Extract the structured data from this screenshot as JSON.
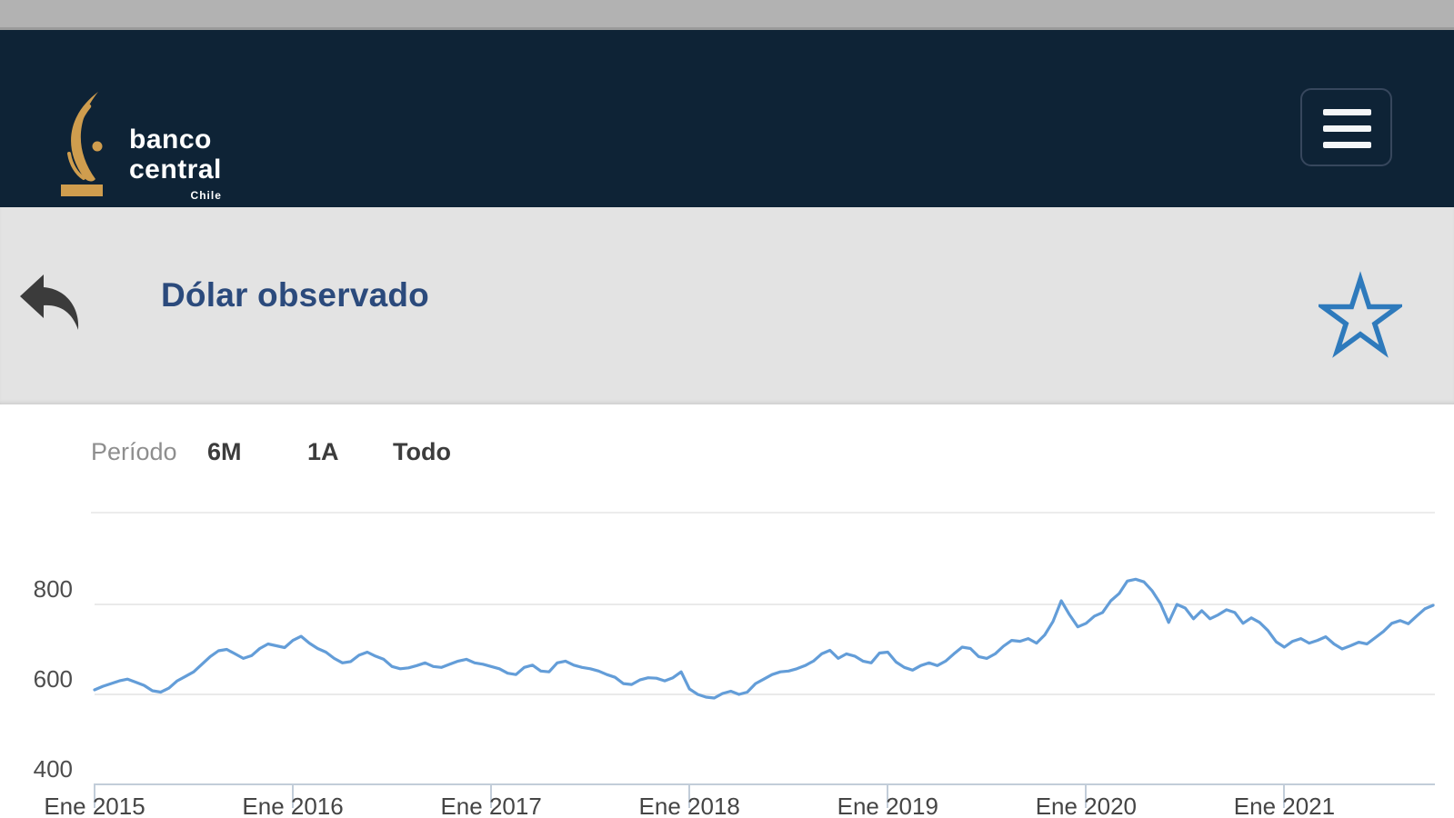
{
  "colors": {
    "status_gray": "#b2b2b2",
    "header_navy": "#0e2336",
    "bg_gray": "#e3e3e3",
    "title_navy": "#2b4a7c",
    "gold": "#cf9d4e",
    "accent_blue": "#2e7abc",
    "line_blue": "#639dd8"
  },
  "header": {
    "logo_line1": "banco",
    "logo_line2": "central",
    "logo_line3": "Chile",
    "menu_icon": "hamburger-icon"
  },
  "title_bar": {
    "title": "Dólar observado",
    "back_icon": "back-arrow-icon",
    "favorite_icon": "star-icon"
  },
  "period_selector": {
    "label": "Período",
    "options": [
      "6M",
      "1A",
      "Todo"
    ]
  },
  "chart_data": {
    "type": "line",
    "title": "Dólar observado",
    "series_name": "Dólar observado",
    "x_tick_labels": [
      "Ene 2015",
      "Ene 2016",
      "Ene 2017",
      "Ene 2018",
      "Ene 2019",
      "Ene 2020",
      "Ene 2021"
    ],
    "y_ticks": [
      800,
      600,
      400
    ],
    "ylim": [
      400,
      1000
    ],
    "grid": "horizontal",
    "legend": "none",
    "x_start": "Ene 2015",
    "x_interval": "half-month",
    "points_per_year": 24,
    "values": [
      608,
      616,
      622,
      628,
      632,
      625,
      618,
      606,
      603,
      612,
      628,
      638,
      648,
      665,
      682,
      695,
      698,
      688,
      678,
      684,
      700,
      710,
      706,
      702,
      718,
      727,
      712,
      700,
      692,
      678,
      668,
      671,
      685,
      692,
      683,
      676,
      660,
      655,
      657,
      662,
      668,
      660,
      658,
      665,
      672,
      676,
      668,
      665,
      660,
      655,
      645,
      642,
      658,
      663,
      650,
      648,
      668,
      672,
      663,
      658,
      655,
      650,
      642,
      636,
      622,
      620,
      630,
      635,
      634,
      628,
      635,
      648,
      610,
      598,
      592,
      590,
      600,
      605,
      598,
      603,
      622,
      632,
      642,
      648,
      650,
      655,
      662,
      672,
      688,
      696,
      678,
      688,
      683,
      672,
      668,
      690,
      692,
      670,
      658,
      652,
      662,
      668,
      662,
      672,
      688,
      703,
      700,
      682,
      678,
      688,
      705,
      718,
      716,
      722,
      712,
      730,
      760,
      806,
      775,
      748,
      756,
      772,
      780,
      806,
      822,
      850,
      854,
      848,
      828,
      800,
      758,
      798,
      790,
      766,
      784,
      766,
      775,
      786,
      780,
      756,
      768,
      758,
      740,
      715,
      703,
      716,
      722,
      712,
      718,
      726,
      710,
      699,
      706,
      714,
      710,
      724,
      738,
      756,
      762,
      755,
      772,
      788,
      796
    ]
  }
}
